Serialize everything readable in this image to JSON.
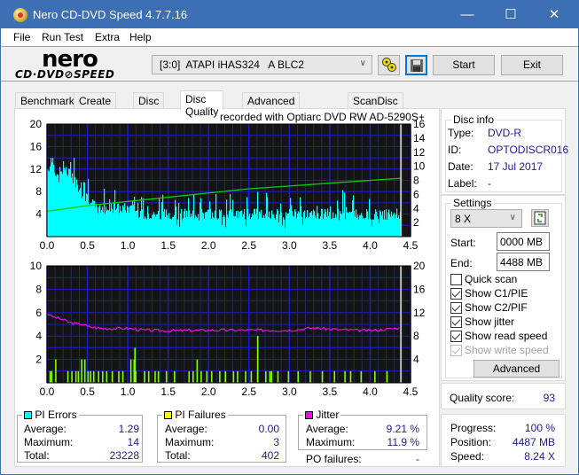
{
  "window": {
    "title": "Nero CD-DVD Speed 4.7.7.16",
    "controls": {
      "minimize": "—",
      "maximize": "☐",
      "close": "✕"
    }
  },
  "menu": [
    "File",
    "Run Test",
    "Extra",
    "Help"
  ],
  "toolbar": {
    "logo_top": "nero",
    "logo_bottom": "CD·DVD⊘SPEED",
    "drive": "[3:0]  ATAPI iHAS324   A BLC2",
    "start_label": "Start",
    "exit_label": "Exit",
    "icons": [
      "drive-properties-icon",
      "save-icon"
    ]
  },
  "tabs": [
    {
      "label": "Benchmark",
      "active": false
    },
    {
      "label": "Create Disc",
      "active": false
    },
    {
      "label": "Disc Info",
      "active": false
    },
    {
      "label": "Disc Quality",
      "active": true
    },
    {
      "label": "Advanced Disc Quality",
      "active": false
    },
    {
      "label": "ScanDisc",
      "active": false
    }
  ],
  "chart_caption": "recorded with Optiarc  DVD RW AD-5290S+",
  "chart_data": [
    {
      "type": "bar",
      "name": "PI Errors",
      "x_ticks": [
        "0.0",
        "0.5",
        "1.0",
        "1.5",
        "2.0",
        "2.5",
        "3.0",
        "3.5",
        "4.0",
        "4.5"
      ],
      "xlim": [
        0,
        4.5
      ],
      "y_left_ticks": [
        "20",
        "16",
        "12",
        "8",
        "4"
      ],
      "ylim_left": [
        0,
        20
      ],
      "y_right_ticks": [
        "16",
        "14",
        "12",
        "10",
        "8",
        "6",
        "4",
        "2"
      ],
      "ylim_right": [
        0,
        16
      ],
      "grid": true,
      "end_position": 4.38,
      "series": [
        {
          "name": "PI Errors",
          "color": "#00ffff",
          "axis": "left",
          "approx_profile": [
            [
              0.0,
              12
            ],
            [
              0.05,
              13
            ],
            [
              0.1,
              11
            ],
            [
              0.2,
              12
            ],
            [
              0.3,
              11
            ],
            [
              0.4,
              8
            ],
            [
              0.5,
              7
            ],
            [
              0.6,
              5
            ],
            [
              0.8,
              5
            ],
            [
              1.0,
              5
            ],
            [
              1.2,
              4
            ],
            [
              1.5,
              4
            ],
            [
              2.0,
              4
            ],
            [
              2.5,
              4
            ],
            [
              3.0,
              4
            ],
            [
              3.5,
              4
            ],
            [
              4.0,
              4
            ],
            [
              4.38,
              4
            ]
          ],
          "max": 14
        },
        {
          "name": "Read Speed",
          "color": "#00d000",
          "axis": "right",
          "values": [
            [
              0.0,
              3.6
            ],
            [
              0.5,
              4.4
            ],
            [
              1.0,
              5.0
            ],
            [
              1.5,
              5.6
            ],
            [
              2.0,
              6.2
            ],
            [
              2.5,
              6.8
            ],
            [
              3.0,
              7.2
            ],
            [
              3.5,
              7.6
            ],
            [
              4.0,
              8.0
            ],
            [
              4.38,
              8.3
            ]
          ]
        }
      ]
    },
    {
      "type": "bar",
      "name": "PI Failures / Jitter",
      "x_ticks": [
        "0.0",
        "0.5",
        "1.0",
        "1.5",
        "2.0",
        "2.5",
        "3.0",
        "3.5",
        "4.0",
        "4.5"
      ],
      "xlim": [
        0,
        4.5
      ],
      "y_left_ticks": [
        "10",
        "8",
        "6",
        "4",
        "2"
      ],
      "ylim_left": [
        0,
        10
      ],
      "y_right_ticks": [
        "20",
        "16",
        "12",
        "8",
        "4"
      ],
      "ylim_right": [
        0,
        20
      ],
      "grid": true,
      "end_position": 4.38,
      "series": [
        {
          "name": "PI Failures",
          "color": "#80ff00",
          "axis": "left",
          "spikes": [
            [
              0.03,
              1
            ],
            [
              0.05,
              1
            ],
            [
              0.1,
              2
            ],
            [
              0.25,
              1
            ],
            [
              0.3,
              1
            ],
            [
              0.35,
              1
            ],
            [
              0.38,
              1
            ],
            [
              0.42,
              2
            ],
            [
              0.46,
              2
            ],
            [
              0.5,
              1
            ],
            [
              0.53,
              1
            ],
            [
              0.57,
              1
            ],
            [
              0.63,
              1
            ],
            [
              0.68,
              1
            ],
            [
              0.73,
              1
            ],
            [
              0.8,
              1
            ],
            [
              0.88,
              1
            ],
            [
              0.93,
              1
            ],
            [
              1.03,
              2
            ],
            [
              1.07,
              2
            ],
            [
              1.09,
              1
            ],
            [
              1.2,
              1
            ],
            [
              1.25,
              1
            ],
            [
              1.33,
              1
            ],
            [
              1.37,
              1
            ],
            [
              1.47,
              1
            ],
            [
              1.57,
              1
            ],
            [
              1.75,
              1
            ],
            [
              1.8,
              1
            ],
            [
              1.85,
              2
            ],
            [
              1.9,
              1
            ],
            [
              1.97,
              1
            ],
            [
              2.03,
              1
            ],
            [
              2.13,
              1
            ],
            [
              2.2,
              1
            ],
            [
              2.3,
              1
            ],
            [
              2.35,
              1
            ],
            [
              2.45,
              1
            ],
            [
              2.52,
              1
            ],
            [
              2.6,
              1
            ],
            [
              2.7,
              1
            ],
            [
              2.75,
              1
            ],
            [
              2.77,
              1
            ],
            [
              2.85,
              1
            ],
            [
              2.98,
              1
            ],
            [
              3.1,
              1
            ],
            [
              3.25,
              1
            ],
            [
              3.4,
              1
            ],
            [
              3.55,
              1
            ],
            [
              3.68,
              1
            ],
            [
              3.75,
              1
            ],
            [
              3.88,
              1
            ],
            [
              4.05,
              1
            ],
            [
              4.2,
              1
            ],
            [
              1.08,
              3
            ],
            [
              2.6,
              4
            ]
          ],
          "max": 3
        },
        {
          "name": "Jitter",
          "color": "#ff00ff",
          "axis": "right",
          "values": [
            [
              0.0,
              12.0
            ],
            [
              0.05,
              11.4
            ],
            [
              0.2,
              10.8
            ],
            [
              0.3,
              10.2
            ],
            [
              0.45,
              10.0
            ],
            [
              0.5,
              9.6
            ],
            [
              0.7,
              9.3
            ],
            [
              1.0,
              9.3
            ],
            [
              1.2,
              9.0
            ],
            [
              1.5,
              8.9
            ],
            [
              2.0,
              9.0
            ],
            [
              2.5,
              9.0
            ],
            [
              3.0,
              9.0
            ],
            [
              3.3,
              9.4
            ],
            [
              3.6,
              9.1
            ],
            [
              4.0,
              8.9
            ],
            [
              4.38,
              9.4
            ]
          ]
        }
      ]
    }
  ],
  "disc_info": {
    "title": "Disc info",
    "rows": [
      {
        "label": "Type:",
        "value": "DVD-R"
      },
      {
        "label": "ID:",
        "value": "OPTODISCR016"
      },
      {
        "label": "Date:",
        "value": "17 Jul 2017"
      },
      {
        "label": "Label:",
        "value": "-"
      }
    ]
  },
  "settings": {
    "title": "Settings",
    "speed": "8 X",
    "start_label": "Start:",
    "start_value": "0000 MB",
    "end_label": "End:",
    "end_value": "4488 MB",
    "checkboxes": [
      {
        "label": "Quick scan",
        "checked": false,
        "enabled": true
      },
      {
        "label": "Show C1/PIE",
        "checked": true,
        "enabled": true
      },
      {
        "label": "Show C2/PIF",
        "checked": true,
        "enabled": true
      },
      {
        "label": "Show jitter",
        "checked": true,
        "enabled": true
      },
      {
        "label": "Show read speed",
        "checked": true,
        "enabled": true
      },
      {
        "label": "Show write speed",
        "checked": true,
        "enabled": false
      }
    ],
    "advanced_label": "Advanced"
  },
  "quality": {
    "label": "Quality score:",
    "value": "93"
  },
  "progress": {
    "rows": [
      {
        "label": "Progress:",
        "value": "100 %"
      },
      {
        "label": "Position:",
        "value": "4487 MB"
      },
      {
        "label": "Speed:",
        "value": "8.24 X"
      }
    ]
  },
  "stats": {
    "pi_errors": {
      "title": "PI Errors",
      "color": "#00ffff",
      "rows": [
        {
          "label": "Average:",
          "value": "1.29"
        },
        {
          "label": "Maximum:",
          "value": "14"
        },
        {
          "label": "Total:",
          "value": "23228"
        }
      ]
    },
    "pi_failures": {
      "title": "PI Failures",
      "color": "#ffff00",
      "rows": [
        {
          "label": "Average:",
          "value": "0.00"
        },
        {
          "label": "Maximum:",
          "value": "3"
        },
        {
          "label": "Total:",
          "value": "402"
        }
      ]
    },
    "jitter": {
      "title": "Jitter",
      "color": "#ff00ff",
      "rows": [
        {
          "label": "Average:",
          "value": "9.21 %"
        },
        {
          "label": "Maximum:",
          "value": "11.9 %"
        }
      ]
    },
    "po_failures": {
      "label": "PO failures:",
      "value": "-"
    }
  }
}
